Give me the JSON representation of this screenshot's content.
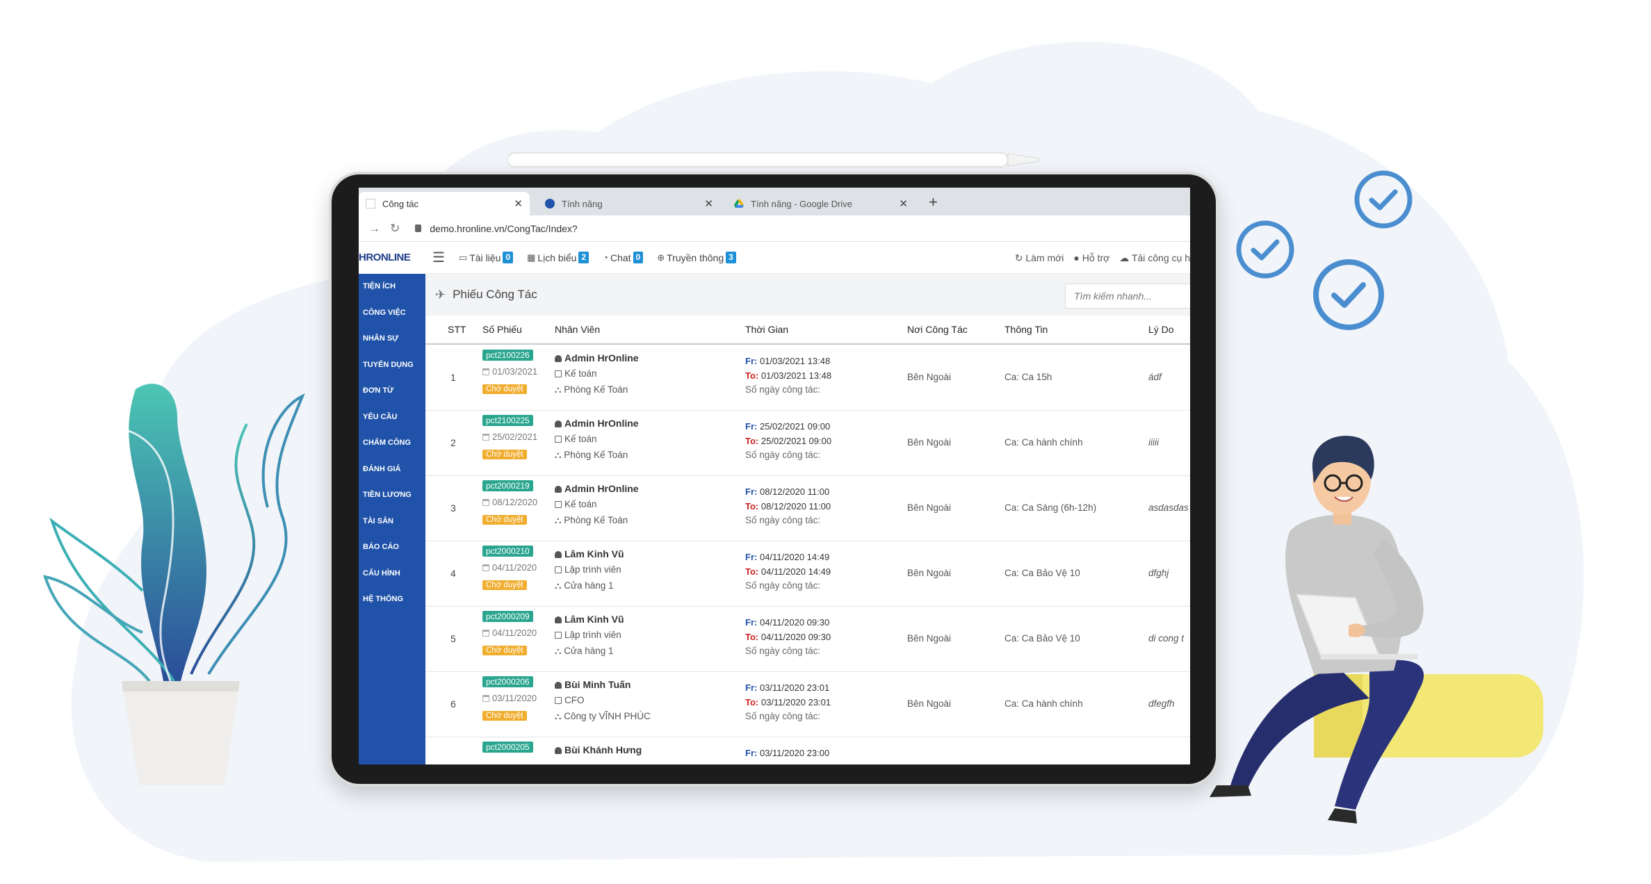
{
  "browser": {
    "tabs": [
      {
        "title": "Công tác",
        "active": true
      },
      {
        "title": "Tính năng",
        "active": false
      },
      {
        "title": "Tính năng - Google Drive",
        "active": false
      }
    ],
    "url": "demo.hronline.vn/CongTac/Index?"
  },
  "app": {
    "logo": "HRONLINE",
    "menu": [
      {
        "label": "Tài liệu",
        "badge": "0"
      },
      {
        "label": "Lịch biểu",
        "badge": "2"
      },
      {
        "label": "Chat",
        "badge": "0"
      },
      {
        "label": "Truyền thông",
        "badge": "3"
      }
    ],
    "right": [
      "Làm mới",
      "Hỗ trợ",
      "Tải công cụ h"
    ]
  },
  "sidebar": {
    "items": [
      "Tiện ích",
      "Công việc",
      "Nhân sự",
      "Tuyển dụng",
      "Đơn từ",
      "Yêu cầu",
      "Chấm công",
      "Đánh giá",
      "Tiền lương",
      "Tài sản",
      "Báo cáo",
      "Cấu hình",
      "Hệ thống"
    ]
  },
  "page": {
    "title": "Phiếu Công Tác",
    "search_placeholder": "Tìm kiếm nhanh..."
  },
  "table": {
    "headers": [
      "STT",
      "Số Phiếu",
      "Nhân Viên",
      "Thời Gian",
      "Nơi Công Tác",
      "Thông Tin",
      "Lý Do"
    ],
    "rows": [
      {
        "stt": "1",
        "code": "pct2100226",
        "date": "01/03/2021",
        "status": "Chờ duyệt",
        "name": "Admin HrOnline",
        "role": "Kế toán",
        "dept": "Phòng Kế Toán",
        "from_label": "Fr:",
        "from": "01/03/2021 13:48",
        "to_label": "To:",
        "to": "01/03/2021 13:48",
        "days": "Số ngày công tác:",
        "place": "Bên Ngoài",
        "info": "Ca: Ca 15h",
        "reason": "ádf"
      },
      {
        "stt": "2",
        "code": "pct2100225",
        "date": "25/02/2021",
        "status": "Chờ duyệt",
        "name": "Admin HrOnline",
        "role": "Kế toán",
        "dept": "Phòng Kế Toán",
        "from_label": "Fr:",
        "from": "25/02/2021 09:00",
        "to_label": "To:",
        "to": "25/02/2021 09:00",
        "days": "Số ngày công tác:",
        "place": "Bên Ngoài",
        "info": "Ca: Ca hành chính",
        "reason": "iiiii"
      },
      {
        "stt": "3",
        "code": "pct2000219",
        "date": "08/12/2020",
        "status": "Chờ duyệt",
        "name": "Admin HrOnline",
        "role": "Kế toán",
        "dept": "Phòng Kế Toán",
        "from_label": "Fr:",
        "from": "08/12/2020 11:00",
        "to_label": "To:",
        "to": "08/12/2020 11:00",
        "days": "Số ngày công tác:",
        "place": "Bên Ngoài",
        "info": "Ca: Ca Sáng (6h-12h)",
        "reason": "asdasdas"
      },
      {
        "stt": "4",
        "code": "pct2000210",
        "date": "04/11/2020",
        "status": "Chờ duyệt",
        "name": "Lâm Kinh Vũ",
        "role": "Lập trình viên",
        "dept": "Cửa hàng 1",
        "from_label": "Fr:",
        "from": "04/11/2020 14:49",
        "to_label": "To:",
        "to": "04/11/2020 14:49",
        "days": "Số ngày công tác:",
        "place": "Bên Ngoài",
        "info": "Ca: Ca Bảo Vệ 10",
        "reason": "dfghj"
      },
      {
        "stt": "5",
        "code": "pct2000209",
        "date": "04/11/2020",
        "status": "Chờ duyệt",
        "name": "Lâm Kinh Vũ",
        "role": "Lập trình viên",
        "dept": "Cửa hàng 1",
        "from_label": "Fr:",
        "from": "04/11/2020 09:30",
        "to_label": "To:",
        "to": "04/11/2020 09:30",
        "days": "Số ngày công tác:",
        "place": "Bên Ngoài",
        "info": "Ca: Ca Bảo Vệ 10",
        "reason": "di cong t"
      },
      {
        "stt": "6",
        "code": "pct2000206",
        "date": "03/11/2020",
        "status": "Chờ duyệt",
        "name": "Bùi Minh Tuấn",
        "role": "CFO",
        "dept": "Công ty VĨNH PHÚC",
        "from_label": "Fr:",
        "from": "03/11/2020 23:01",
        "to_label": "To:",
        "to": "03/11/2020 23:01",
        "days": "Số ngày công tác:",
        "place": "Bên Ngoài",
        "info": "Ca: Ca hành chính",
        "reason": "dfegfh"
      },
      {
        "stt": "",
        "code": "pct2000205",
        "date": "",
        "status": "",
        "name": "Bùi Khánh Hưng",
        "role": "",
        "dept": "",
        "from_label": "Fr:",
        "from": "03/11/2020 23:00",
        "to_label": "",
        "to": "",
        "days": "",
        "place": "",
        "info": "",
        "reason": ""
      }
    ]
  },
  "colors": {
    "sidebar": "#1f52a8",
    "code_badge": "#2aa58f",
    "status_badge": "#f0ad2e",
    "check_circle": "#4b8ed0",
    "background_blob": "#f1f4f9"
  },
  "icons": [
    "check-circle-icon",
    "plant-illustration",
    "person-illustration",
    "stylus-pen"
  ]
}
